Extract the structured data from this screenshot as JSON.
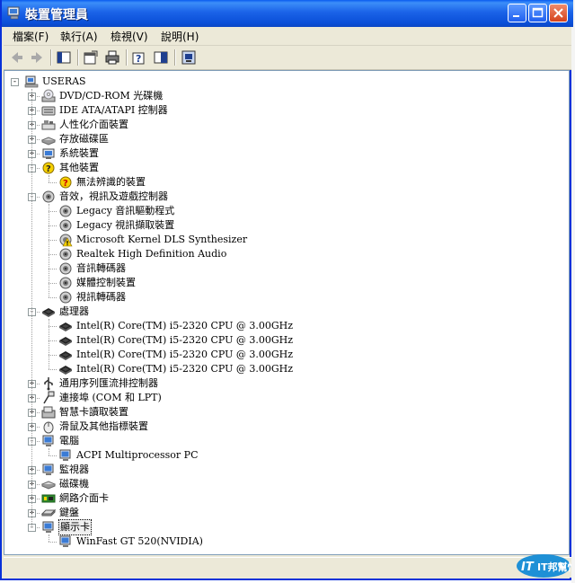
{
  "window": {
    "title": "裝置管理員"
  },
  "menu": [
    "檔案(F)",
    "執行(A)",
    "檢視(V)",
    "說明(H)"
  ],
  "toolbar_icons": [
    "back-icon",
    "forward-icon",
    "console-tree-icon",
    "properties-icon",
    "print-icon",
    "help-icon",
    "show-hide-icon",
    "scan-hardware-icon"
  ],
  "tree": [
    {
      "label": "USERAS",
      "level": 0,
      "icon": "computer-icon",
      "expander": "-"
    },
    {
      "label": "DVD/CD-ROM 光碟機",
      "level": 1,
      "icon": "cdrom-icon",
      "expander": "+"
    },
    {
      "label": "IDE ATA/ATAPI 控制器",
      "level": 1,
      "icon": "ide-controller-icon",
      "expander": "+"
    },
    {
      "label": "人性化介面裝置",
      "level": 1,
      "icon": "hid-icon",
      "expander": "+"
    },
    {
      "label": "存放磁碟區",
      "level": 1,
      "icon": "volume-icon",
      "expander": "+"
    },
    {
      "label": "系統裝置",
      "level": 1,
      "icon": "system-device-icon",
      "expander": "+"
    },
    {
      "label": "其他裝置",
      "level": 1,
      "icon": "other-device-icon",
      "expander": "-"
    },
    {
      "label": "無法辨識的裝置",
      "level": 2,
      "icon": "unknown-device-warning-icon",
      "expander": ""
    },
    {
      "label": "音效，視訊及遊戲控制器",
      "level": 1,
      "icon": "sound-icon",
      "expander": "-"
    },
    {
      "label": "Legacy 音訊驅動程式",
      "level": 2,
      "icon": "sound-icon",
      "expander": ""
    },
    {
      "label": "Legacy 視訊擷取裝置",
      "level": 2,
      "icon": "sound-icon",
      "expander": ""
    },
    {
      "label": "Microsoft Kernel DLS Synthesizer",
      "level": 2,
      "icon": "sound-warning-icon",
      "expander": ""
    },
    {
      "label": "Realtek High Definition Audio",
      "level": 2,
      "icon": "sound-icon",
      "expander": ""
    },
    {
      "label": "音訊轉碼器",
      "level": 2,
      "icon": "sound-icon",
      "expander": ""
    },
    {
      "label": "媒體控制裝置",
      "level": 2,
      "icon": "sound-icon",
      "expander": ""
    },
    {
      "label": "視訊轉碼器",
      "level": 2,
      "icon": "sound-icon",
      "expander": ""
    },
    {
      "label": "處理器",
      "level": 1,
      "icon": "processor-icon",
      "expander": "-"
    },
    {
      "label": "Intel(R) Core(TM) i5-2320 CPU @ 3.00GHz",
      "level": 2,
      "icon": "processor-icon",
      "expander": ""
    },
    {
      "label": "Intel(R) Core(TM) i5-2320 CPU @ 3.00GHz",
      "level": 2,
      "icon": "processor-icon",
      "expander": ""
    },
    {
      "label": "Intel(R) Core(TM) i5-2320 CPU @ 3.00GHz",
      "level": 2,
      "icon": "processor-icon",
      "expander": ""
    },
    {
      "label": "Intel(R) Core(TM) i5-2320 CPU @ 3.00GHz",
      "level": 2,
      "icon": "processor-icon",
      "expander": ""
    },
    {
      "label": "通用序列匯流排控制器",
      "level": 1,
      "icon": "usb-icon",
      "expander": "+"
    },
    {
      "label": "連接埠 (COM 和 LPT)",
      "level": 1,
      "icon": "port-icon",
      "expander": "+"
    },
    {
      "label": "智慧卡讀取裝置",
      "level": 1,
      "icon": "smartcard-icon",
      "expander": "+"
    },
    {
      "label": "滑鼠及其他指標裝置",
      "level": 1,
      "icon": "mouse-icon",
      "expander": "+"
    },
    {
      "label": "電腦",
      "level": 1,
      "icon": "monitor-computer-icon",
      "expander": "-"
    },
    {
      "label": "ACPI Multiprocessor PC",
      "level": 2,
      "icon": "monitor-computer-icon",
      "expander": ""
    },
    {
      "label": "監視器",
      "level": 1,
      "icon": "monitor-computer-icon",
      "expander": "+"
    },
    {
      "label": "磁碟機",
      "level": 1,
      "icon": "disk-icon",
      "expander": "+"
    },
    {
      "label": "網路介面卡",
      "level": 1,
      "icon": "network-card-icon",
      "expander": "+"
    },
    {
      "label": "鍵盤",
      "level": 1,
      "icon": "keyboard-icon",
      "expander": "+"
    },
    {
      "label": "顯示卡",
      "level": 1,
      "icon": "monitor-computer-icon",
      "expander": "-",
      "selected": true
    },
    {
      "label": "WinFast GT 520(NVIDIA)",
      "level": 2,
      "icon": "monitor-computer-icon",
      "expander": ""
    }
  ],
  "watermark": "IT邦幫忙"
}
